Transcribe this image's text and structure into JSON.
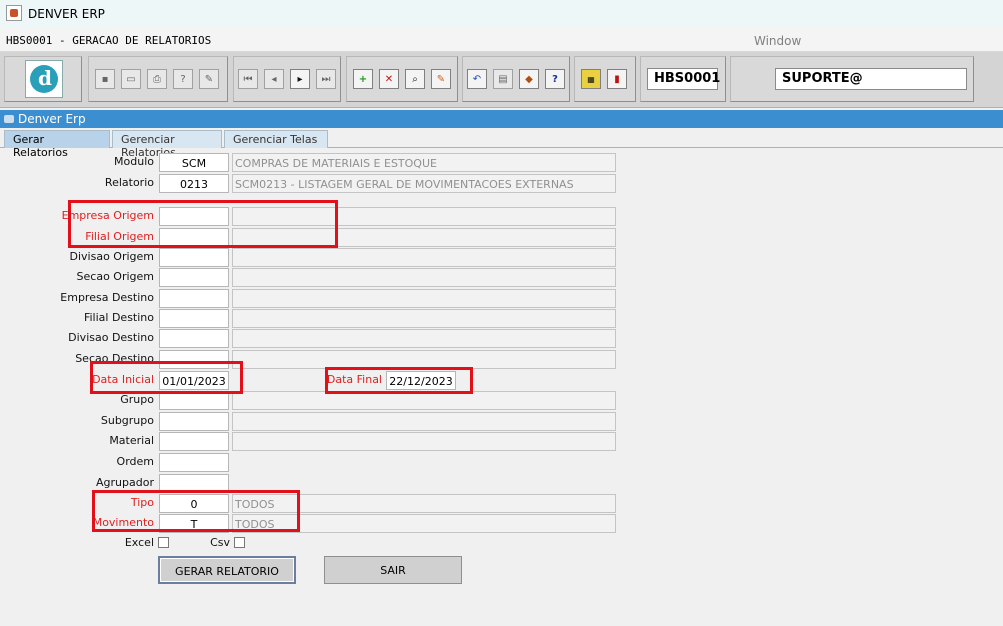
{
  "window": {
    "title": "DENVER ERP",
    "screen_title": "HBS0001 - GERACAO DE RELATORIOS",
    "window_menu": "Window"
  },
  "toolbar": {
    "screen_code": "HBS0001",
    "user": "SUPORTE@"
  },
  "frame": {
    "title": "Denver Erp"
  },
  "tabs": [
    "Gerar Relatorios",
    "Gerenciar Relatorios",
    "Gerenciar Telas"
  ],
  "form": {
    "modulo": {
      "label": "Modulo",
      "code": "SCM",
      "desc": "COMPRAS DE MATERIAIS E ESTOQUE"
    },
    "relatorio": {
      "label": "Relatorio",
      "code": "0213",
      "desc": "SCM0213 - LISTAGEM GERAL DE MOVIMENTACOES EXTERNAS"
    },
    "fields": [
      {
        "label": "Empresa Origem",
        "value": "",
        "desc": ""
      },
      {
        "label": "Filial Origem",
        "value": "",
        "desc": ""
      },
      {
        "label": "Divisao Origem",
        "value": "",
        "desc": ""
      },
      {
        "label": "Secao Origem",
        "value": "",
        "desc": ""
      },
      {
        "label": "Empresa Destino",
        "value": "",
        "desc": ""
      },
      {
        "label": "Filial Destino",
        "value": "",
        "desc": ""
      },
      {
        "label": "Divisao Destino",
        "value": "",
        "desc": ""
      },
      {
        "label": "Secao Destino",
        "value": "",
        "desc": ""
      }
    ],
    "data_inicial": {
      "label": "Data Inicial",
      "value": "01/01/2023"
    },
    "data_final": {
      "label": "Data Final",
      "value": "22/12/2023"
    },
    "grupo": {
      "label": "Grupo",
      "value": ""
    },
    "subgrupo": {
      "label": "Subgrupo",
      "value": ""
    },
    "material": {
      "label": "Material",
      "value": ""
    },
    "ordem": {
      "label": "Ordem",
      "value": ""
    },
    "agrupador": {
      "label": "Agrupador",
      "value": ""
    },
    "tipo": {
      "label": "Tipo",
      "value": "0",
      "desc": "TODOS"
    },
    "movimento": {
      "label": "Movimento",
      "value": "T",
      "desc": "TODOS"
    },
    "excel": {
      "label": "Excel"
    },
    "csv": {
      "label": "Csv"
    }
  },
  "buttons": {
    "gerar": "GERAR RELATORIO",
    "sair": "SAIR"
  },
  "colors": {
    "highlight": "#e3101a",
    "required_label": "#e02020",
    "frame_bar": "#3b8fd0"
  }
}
